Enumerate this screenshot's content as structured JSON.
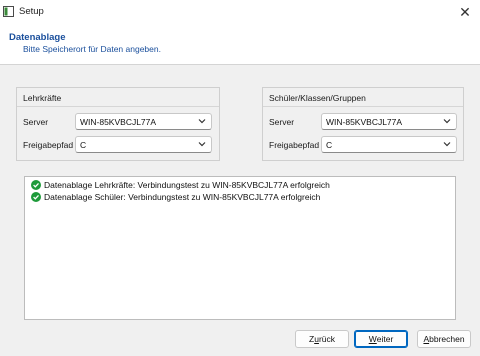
{
  "window": {
    "title": "Setup"
  },
  "header": {
    "title": "Datenablage",
    "subtitle": "Bitte Speicherort für Daten angeben."
  },
  "left_group": {
    "title": "Lehrkräfte",
    "server_label": "Server",
    "server_value": "WIN-85KVBCJL77A",
    "share_label": "Freigabepfad",
    "share_value": "C"
  },
  "right_group": {
    "title": "Schüler/Klassen/Gruppen",
    "server_label": "Server",
    "server_value": "WIN-85KVBCJL77A",
    "share_label": "Freigabepfad",
    "share_value": "C"
  },
  "log": [
    {
      "icon": "check-circle-icon",
      "text": "Datenablage Lehrkräfte: Verbindungstest zu WIN-85KVBCJL77A erfolgreich"
    },
    {
      "icon": "check-circle-icon",
      "text": "Datenablage Schüler: Verbindungstest zu WIN-85KVBCJL77A erfolgreich"
    }
  ],
  "buttons": {
    "back": {
      "pre": "Z",
      "u": "u",
      "post": "rück"
    },
    "next": {
      "pre": "",
      "u": "W",
      "post": "eiter"
    },
    "cancel": {
      "pre": "",
      "u": "A",
      "post": "bbrechen"
    }
  },
  "colors": {
    "accent": "#0067c0",
    "header_text": "#1a4f9c",
    "success": "#1e9a3a"
  }
}
